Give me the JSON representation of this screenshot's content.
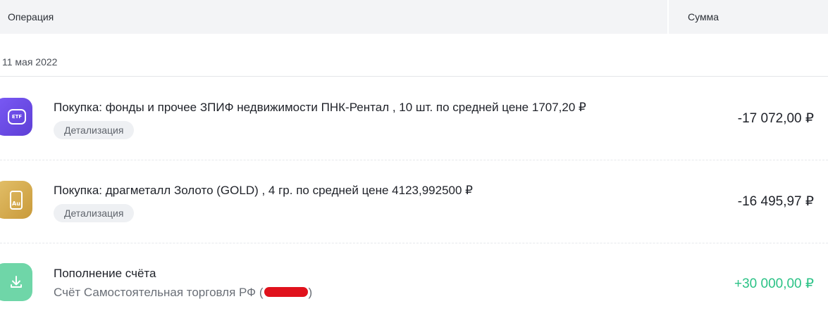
{
  "header": {
    "operation_label": "Операция",
    "amount_label": "Сумма"
  },
  "date_group": "11 мая 2022",
  "operations": [
    {
      "icon": "etf-icon",
      "icon_text": "ETF",
      "title": "Покупка: фонды и прочее ЗПИФ недвижимости ПНК-Рентал , 10 шт. по средней цене 1707,20 ₽",
      "details_label": "Детализация",
      "amount": "-17 072,00 ₽"
    },
    {
      "icon": "gold-icon",
      "icon_text": "Au",
      "title": "Покупка: драгметалл Золото (GOLD) , 4 гр. по средней цене 4123,992500 ₽",
      "details_label": "Детализация",
      "amount": "-16 495,97 ₽"
    },
    {
      "icon": "download-icon",
      "title": "Пополнение счёта",
      "subtitle_prefix": "Счёт Самостоятельная торговля РФ (",
      "subtitle_suffix": ")",
      "amount": "+30 000,00 ₽",
      "amount_color": "#2bc286"
    }
  ]
}
